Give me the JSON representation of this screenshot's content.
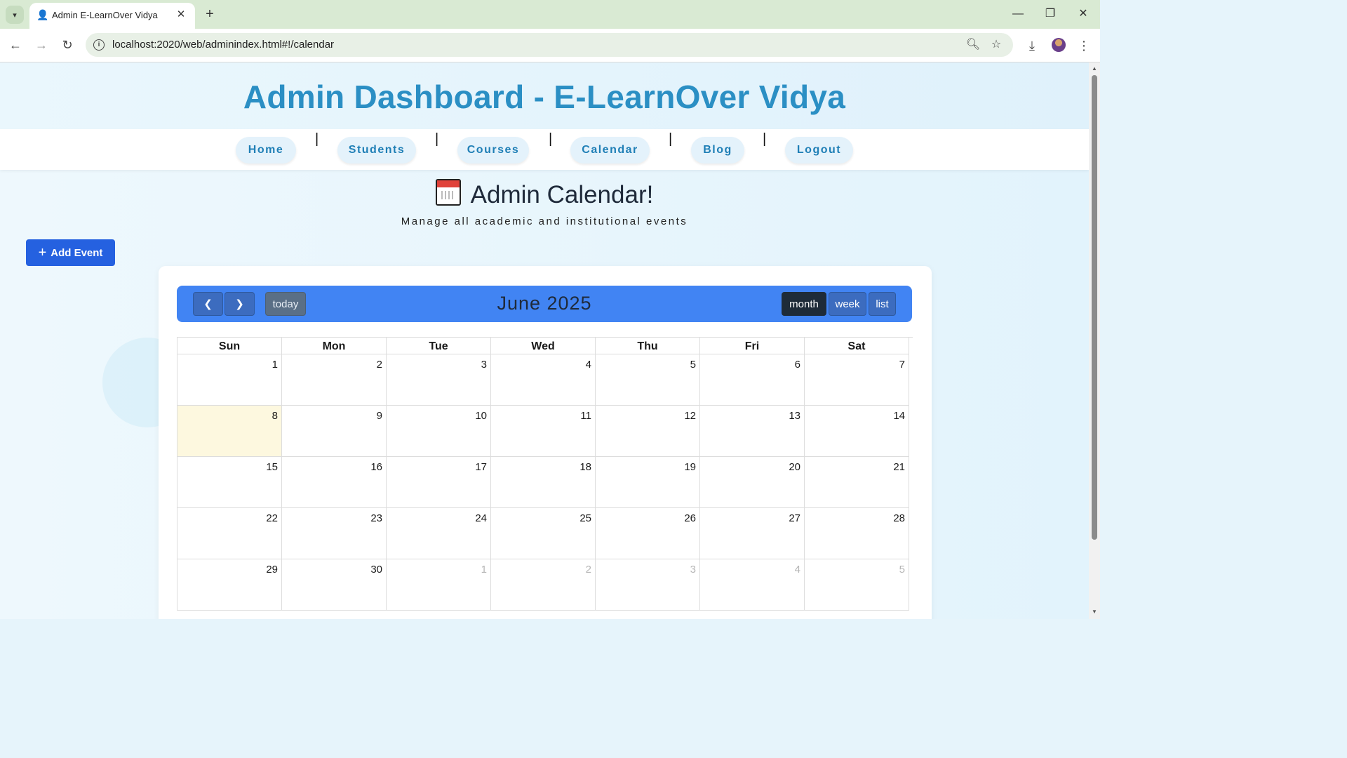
{
  "browser": {
    "tab_title": "Admin E-LearnOver Vidya",
    "url": "localhost:2020/web/adminindex.html#!/calendar"
  },
  "site": {
    "title": "Admin Dashboard - E-LearnOver Vidya",
    "nav": [
      "Home",
      "Students",
      "Courses",
      "Calendar",
      "Blog",
      "Logout"
    ],
    "separator": "|"
  },
  "calendar_page": {
    "heading": "Admin Calendar!",
    "subtitle": "Manage all academic and institutional events",
    "add_event_label": "Add Event"
  },
  "calendar": {
    "title": "June 2025",
    "today_label": "today",
    "view_buttons": [
      "month",
      "week",
      "list"
    ],
    "active_view": "month",
    "weekdays": [
      "Sun",
      "Mon",
      "Tue",
      "Wed",
      "Thu",
      "Fri",
      "Sat"
    ],
    "weeks": [
      [
        "1",
        "2",
        "3",
        "4",
        "5",
        "6",
        "7"
      ],
      [
        "8",
        "9",
        "10",
        "11",
        "12",
        "13",
        "14"
      ],
      [
        "15",
        "16",
        "17",
        "18",
        "19",
        "20",
        "21"
      ],
      [
        "22",
        "23",
        "24",
        "25",
        "26",
        "27",
        "28"
      ],
      [
        "29",
        "30",
        "1",
        "2",
        "3",
        "4",
        "5"
      ]
    ],
    "today_date": "8",
    "colors": {
      "toolbar": "#4184f3",
      "today_bg": "#fdf8df",
      "accent": "#2b8fc4"
    }
  }
}
